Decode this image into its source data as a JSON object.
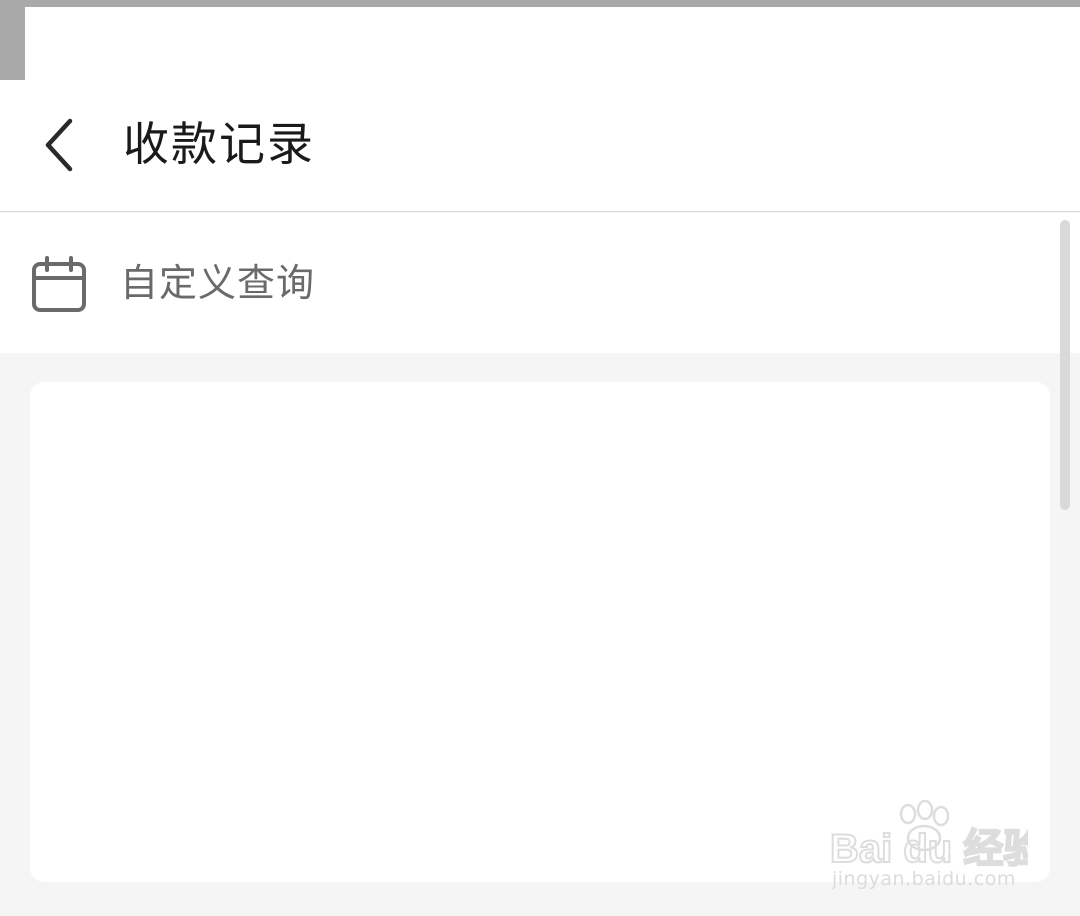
{
  "header": {
    "title": "收款记录",
    "back_icon": "chevron-left-icon"
  },
  "filter": {
    "icon": "calendar-icon",
    "label": "自定义查询"
  },
  "colors": {
    "background": "#f5f5f5",
    "surface": "#ffffff",
    "title_text": "#1a1a1a",
    "secondary_text": "#6a6a6a",
    "status_strip": "#a9a9a9"
  },
  "watermark": {
    "brand": "Bai  du 经验",
    "url": "jingyan.baidu.com"
  }
}
